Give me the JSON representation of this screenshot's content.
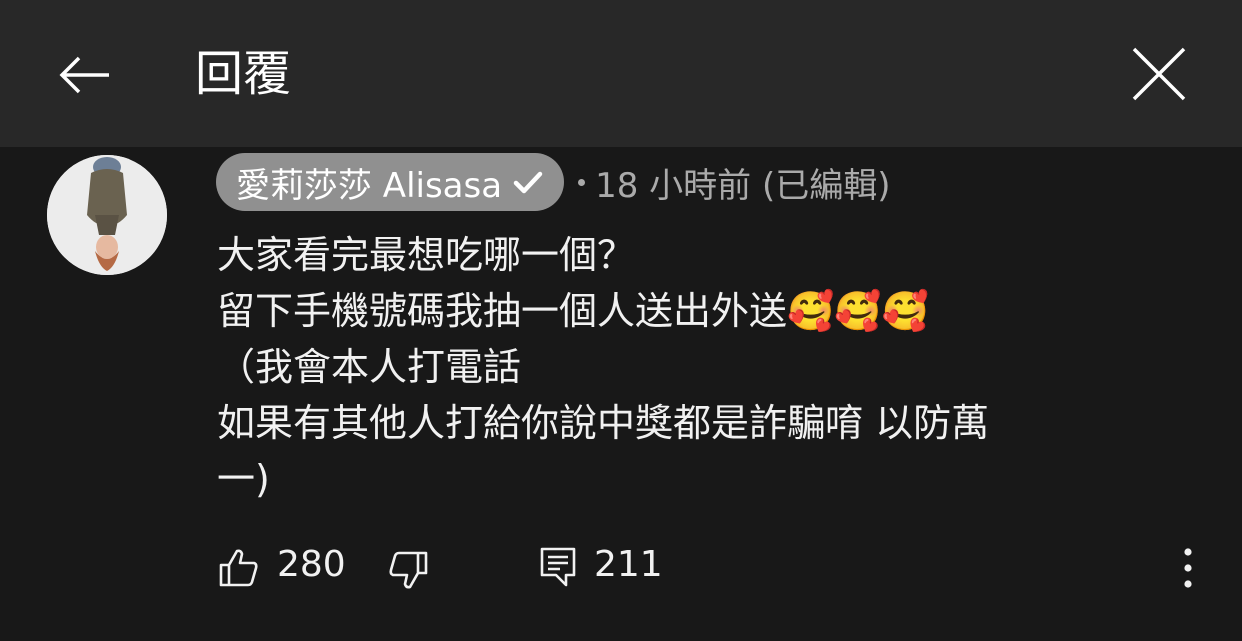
{
  "header": {
    "title": "回覆",
    "back_icon": "arrow-left-icon",
    "close_icon": "close-icon"
  },
  "comment": {
    "author": "愛莉莎莎 Alisasa",
    "verified": true,
    "time": "18 小時前 (已編輯)",
    "lines": [
      "大家看完最想吃哪一個？",
      "留下手機號碼我抽一個人送出外送🥰🥰🥰",
      "（我會本人打電話",
      "如果有其他人打給你說中獎都是詐騙唷 以防萬",
      "一)"
    ],
    "likes": "280",
    "replies": "211"
  },
  "colors": {
    "background": "#181818",
    "header": "#282828",
    "author_chip": "#909090",
    "secondary_text": "#aaaaaa"
  }
}
